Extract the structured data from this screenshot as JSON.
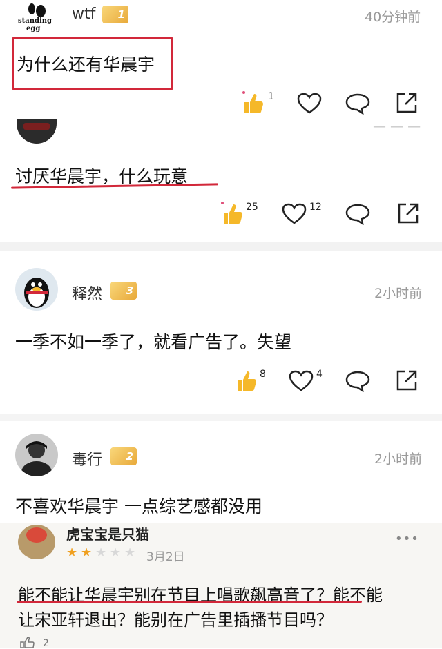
{
  "comments": [
    {
      "username": "wtf",
      "badge_level": "1",
      "time": "40分钟前",
      "avatar_text": "standing egg",
      "text": "为什么还有华晨宇",
      "likes": "1",
      "hearts": ""
    },
    {
      "username": "",
      "badge_level": "",
      "time": "",
      "avatar_text": "",
      "text": "讨厌华晨宇，什么玩意",
      "likes": "25",
      "hearts": "12"
    },
    {
      "username": "释然",
      "badge_level": "3",
      "time": "2小时前",
      "text": "一季不如一季了，就看广告了。失望",
      "likes": "8",
      "hearts": "4"
    },
    {
      "username": "毒行",
      "badge_level": "2",
      "time": "2小时前",
      "text": "不喜欢华晨宇 一点综艺感都没用"
    }
  ],
  "review": {
    "username": "虎宝宝是只猫",
    "rating": 2,
    "rating_max": 5,
    "date": "3月2日",
    "more": "•••",
    "text_line1": "能不能让华晨宇别在节目上唱歌飙高音了？能不能",
    "text_line2": "让宋亚轩退出？能别在广告里插播节目吗？",
    "likes": "2"
  },
  "colors": {
    "highlight_red": "#d2283a",
    "thumb_yellow": "#f5b829",
    "badge_gold": "#e8a93a",
    "muted_gray": "#9a9a9a"
  },
  "icons": [
    "thumb-up-icon",
    "heart-icon",
    "comment-icon",
    "share-icon",
    "more-icon",
    "star-icon"
  ]
}
